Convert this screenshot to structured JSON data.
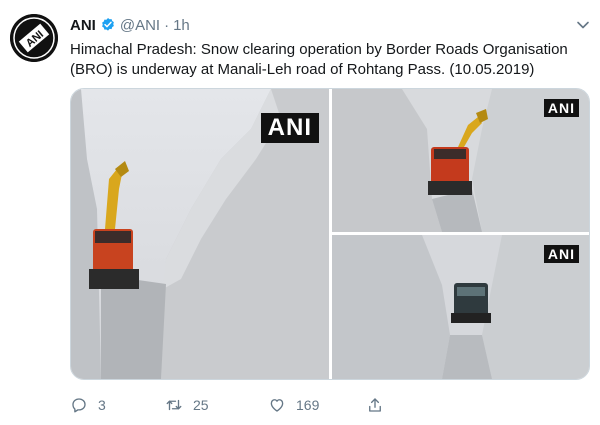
{
  "tweet": {
    "avatar_label": "ANI",
    "name": "ANI",
    "handle": "@ANI",
    "separator": "·",
    "time": "1h",
    "text": "Himachal Pradesh: Snow clearing operation by Border Roads Organisation (BRO) is underway at Manali-Leh road of Rohtang Pass. (10.05.2019)",
    "media": {
      "watermark": "ANI"
    },
    "actions": {
      "reply_count": "3",
      "retweet_count": "25",
      "like_count": "169"
    }
  },
  "colors": {
    "text_primary": "#14171a",
    "text_secondary": "#657786",
    "verified_blue": "#1da1f2",
    "border": "#ccd6dd"
  },
  "icons": [
    "verified-badge-icon",
    "chevron-down-icon",
    "reply-icon",
    "retweet-icon",
    "heart-icon",
    "share-icon"
  ]
}
